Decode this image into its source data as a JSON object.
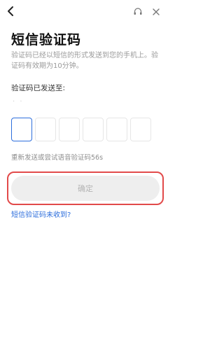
{
  "header": {
    "back_icon": "chevron-left-icon",
    "service_icon": "headset-icon",
    "close_icon": "close-icon"
  },
  "title": "短信验证码",
  "description": "验证码已经以短信的形式发送到您的手机上。验证码有效期为10分钟。",
  "sent_to_label": "验证码已发送至:",
  "phone_masked": "· ·",
  "code_boxes": [
    "",
    "",
    "",
    "",
    "",
    ""
  ],
  "resend_text": "重新发送或尝试语音验证码56s",
  "confirm_label": "确定",
  "no_code_link": "短信验证码未收到?",
  "colors": {
    "accent": "#2d6edc",
    "highlight_border": "#e24a4a",
    "button_disabled_bg": "#eeeeee",
    "button_disabled_text": "#b4b4b4"
  }
}
